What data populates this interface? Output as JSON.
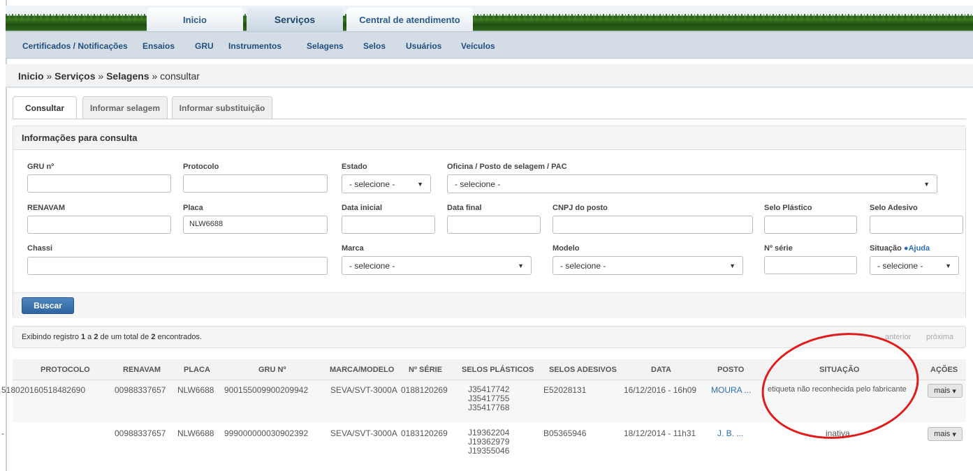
{
  "main_tabs": [
    "Inicio",
    "Serviços",
    "Central de atendimento"
  ],
  "subnav": [
    "Certificados / Notificações",
    "Ensaios",
    "GRU",
    "Instrumentos",
    "Selagens",
    "Selos",
    "Usuários",
    "Veículos"
  ],
  "breadcrumb": {
    "inicio": "Inicio",
    "sep1": " » ",
    "servicos": "Serviços",
    "sep2": " » ",
    "selagens": "Selagens",
    "sep3": " » ",
    "current": "consultar"
  },
  "tabs": [
    "Consultar",
    "Informar selagem",
    "Informar substituição"
  ],
  "form": {
    "title": "Informações para consulta",
    "labels": {
      "gru": "GRU nº",
      "protocolo": "Protocolo",
      "estado": "Estado",
      "oficina": "Oficina / Posto de selagem / PAC",
      "renavam": "RENAVAM",
      "placa": "Placa",
      "data_inicial": "Data inicial",
      "data_final": "Data final",
      "cnpj": "CNPJ do posto",
      "selo_plastico": "Selo Plástico",
      "selo_adesivo": "Selo Adesivo",
      "chassi": "Chassi",
      "marca": "Marca",
      "modelo": "Modelo",
      "serie": "Nº série",
      "situacao": "Situação",
      "ajuda": "Ajuda"
    },
    "values": {
      "placa": "NLW6688"
    },
    "select_placeholder": "- selecione -",
    "buscar": "Buscar"
  },
  "results": {
    "prefix": "Exibindo registro ",
    "from": "1",
    "mid1": " a ",
    "to": "2",
    "mid2": " de um total de ",
    "total": "2",
    "suffix": " encontrados.",
    "anterior": "anterior",
    "proxima": "próxima"
  },
  "columns": [
    "PROTOCOLO",
    "RENAVAM",
    "PLACA",
    "GRU Nº",
    "MARCA/MODELO",
    "Nº SÉRIE",
    "SELOS PLÁSTICOS",
    "SELOS ADESIVOS",
    "DATA",
    "POSTO",
    "SITUAÇÃO",
    "AÇÕES"
  ],
  "rows": [
    {
      "protocolo": "518020160518482690",
      "renavam": "00988337657",
      "placa": "NLW6688",
      "gru": "900155009900209942",
      "marca": "SEVA/SVT-3000A",
      "serie": "0188120269",
      "selos_plasticos": [
        "J35417742",
        "J35417755",
        "J35417768"
      ],
      "selos_adesivos": "E52028131",
      "data": "16/12/2016 - 16h09",
      "posto": "MOURA ...",
      "situacao": "etiqueta não reconhecida pelo fabricante",
      "acao": "mais"
    },
    {
      "protocolo": "-",
      "renavam": "00988337657",
      "placa": "NLW6688",
      "gru": "999000000030902392",
      "marca": "SEVA/SVT-3000A",
      "serie": "0183120269",
      "selos_plasticos": [
        "J19362204",
        "J19362979",
        "J19355046"
      ],
      "selos_adesivos": "B05365946",
      "data": "18/12/2014 - 11h31",
      "posto": "J. B. ...",
      "situacao": "inativa",
      "acao": "mais"
    }
  ],
  "colors": {
    "link": "#2a6fb5",
    "annotation": "#e01b1b",
    "primary_button": "#2f65a0"
  }
}
